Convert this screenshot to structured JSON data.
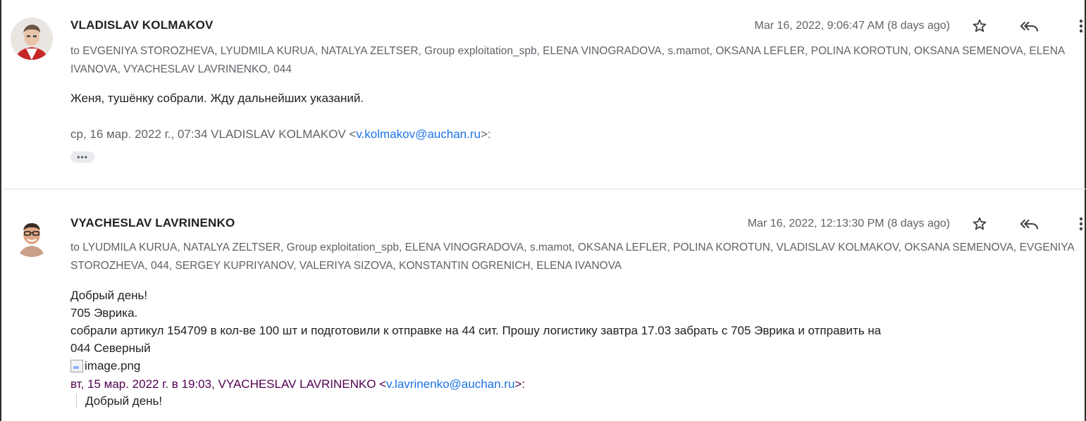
{
  "messages": [
    {
      "sender": "VLADISLAV KOLMAKOV",
      "date": "Mar 16, 2022, 9:06:47 AM (8 days ago)",
      "recipients": "to EVGENIYA STOROZHEVA, LYUDMILA KURUA, NATALYA ZELTSER, Group exploitation_spb, ELENA VINOGRADOVA, s.mamot, OKSANA LEFLER, POLINA KOROTUN, OKSANA SEMENOVA, ELENA IVANOVA, VYACHESLAV LAVRINENKO, 044",
      "body": "Женя, тушёнку собрали. Жду дальнейших указаний.",
      "quote_header_prefix": "ср, 16 мар. 2022 г., 07:34 VLADISLAV KOLMAKOV <",
      "quote_header_email": "v.kolmakov@auchan.ru",
      "quote_header_suffix": ">:",
      "trimmed_content_label": "•••",
      "icons": [
        "star-icon",
        "reply-all-icon",
        "more-vert-icon"
      ]
    },
    {
      "sender": "VYACHESLAV LAVRINENKO",
      "date": "Mar 16, 2022, 12:13:30 PM (8 days ago)",
      "recipients": "to LYUDMILA KURUA, NATALYA ZELTSER, Group exploitation_spb, ELENA VINOGRADOVA, s.mamot, OKSANA LEFLER, POLINA KOROTUN, VLADISLAV KOLMAKOV, OKSANA SEMENOVA, EVGENIYA STOROZHEVA, 044, SERGEY KUPRIYANOV, VALERIYA SIZOVA, KONSTANTIN OGRENICH, ELENA IVANOVA",
      "body_lines": [
        "Добрый день!",
        "705 Эврика.",
        "собрали артикул 154709 в кол-ве 100 шт и подготовили к отправке на 44 сит. Прошу логистику завтра 17.03 забрать с 705 Эврика и отправить на",
        "044 Северный"
      ],
      "image_alt": "image.png",
      "quote_header_prefix": "вт, 15 мар. 2022 г. в 19:03, VYACHESLAV LAVRINENKO <",
      "quote_header_email": "v.lavrinenko@auchan.ru",
      "quote_header_suffix": ">:",
      "quoted_text": "Добрый день!",
      "icons": [
        "star-icon",
        "reply-all-icon",
        "more-vert-icon"
      ]
    }
  ]
}
